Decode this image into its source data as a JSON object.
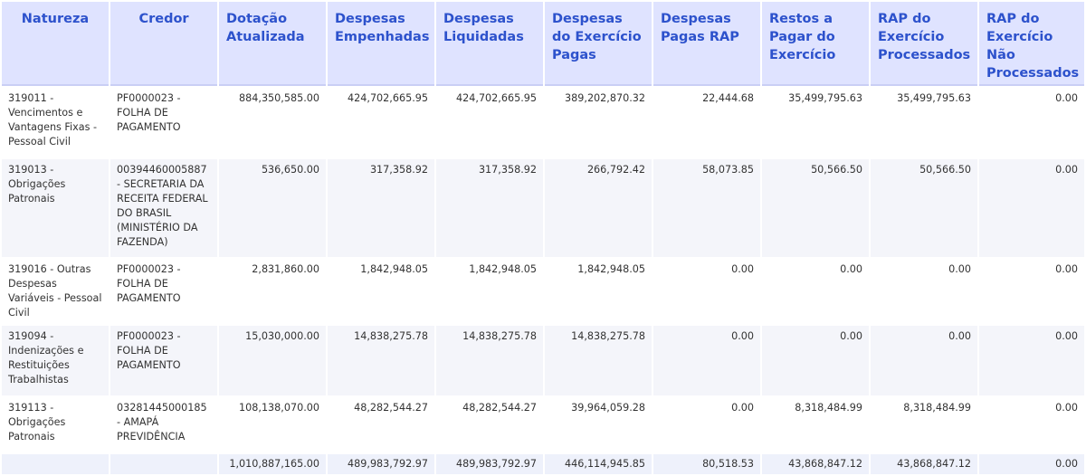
{
  "table": {
    "headers": [
      "Natureza",
      "Credor",
      "Dotação Atualizada",
      "Despesas Empenhadas",
      "Despesas Liquidadas",
      "Despesas do Exercício Pagas",
      "Despesas Pagas RAP",
      "Restos a Pagar do Exercício",
      "RAP do Exercício Processados",
      "RAP do Exercício Não Processados"
    ],
    "rows": [
      {
        "natureza": "319011 - Vencimentos e Vantagens Fixas - Pessoal Civil",
        "credor": "PF0000023 - FOLHA DE PAGAMENTO",
        "dotacao": "884,350,585.00",
        "empenhadas": "424,702,665.95",
        "liquidadas": "424,702,665.95",
        "pagas": "389,202,870.32",
        "pagas_rap": "22,444.68",
        "restos": "35,499,795.63",
        "rap_proc": "35,499,795.63",
        "rap_nao_proc": "0.00"
      },
      {
        "natureza": "319013 - Obrigações Patronais",
        "credor": "00394460005887 - SECRETARIA DA RECEITA FEDERAL DO BRASIL (MINISTÉRIO DA FAZENDA)",
        "dotacao": "536,650.00",
        "empenhadas": "317,358.92",
        "liquidadas": "317,358.92",
        "pagas": "266,792.42",
        "pagas_rap": "58,073.85",
        "restos": "50,566.50",
        "rap_proc": "50,566.50",
        "rap_nao_proc": "0.00"
      },
      {
        "natureza": "319016 - Outras Despesas Variáveis - Pessoal Civil",
        "credor": "PF0000023 - FOLHA DE PAGAMENTO",
        "dotacao": "2,831,860.00",
        "empenhadas": "1,842,948.05",
        "liquidadas": "1,842,948.05",
        "pagas": "1,842,948.05",
        "pagas_rap": "0.00",
        "restos": "0.00",
        "rap_proc": "0.00",
        "rap_nao_proc": "0.00"
      },
      {
        "natureza": "319094 - Indenizações e Restituições Trabalhistas",
        "credor": "PF0000023 - FOLHA DE PAGAMENTO",
        "dotacao": "15,030,000.00",
        "empenhadas": "14,838,275.78",
        "liquidadas": "14,838,275.78",
        "pagas": "14,838,275.78",
        "pagas_rap": "0.00",
        "restos": "0.00",
        "rap_proc": "0.00",
        "rap_nao_proc": "0.00"
      },
      {
        "natureza": "319113 - Obrigações Patronais",
        "credor": "03281445000185 - AMAPÁ PREVIDÊNCIA",
        "dotacao": "108,138,070.00",
        "empenhadas": "48,282,544.27",
        "liquidadas": "48,282,544.27",
        "pagas": "39,964,059.28",
        "pagas_rap": "0.00",
        "restos": "8,318,484.99",
        "rap_proc": "8,318,484.99",
        "rap_nao_proc": "0.00"
      }
    ],
    "totals": {
      "natureza": "",
      "credor": "",
      "dotacao": "1,010,887,165.00",
      "empenhadas": "489,983,792.97",
      "liquidadas": "489,983,792.97",
      "pagas": "446,114,945.85",
      "pagas_rap": "80,518.53",
      "restos": "43,868,847.12",
      "rap_proc": "43,868,847.12",
      "rap_nao_proc": "0.00"
    }
  }
}
